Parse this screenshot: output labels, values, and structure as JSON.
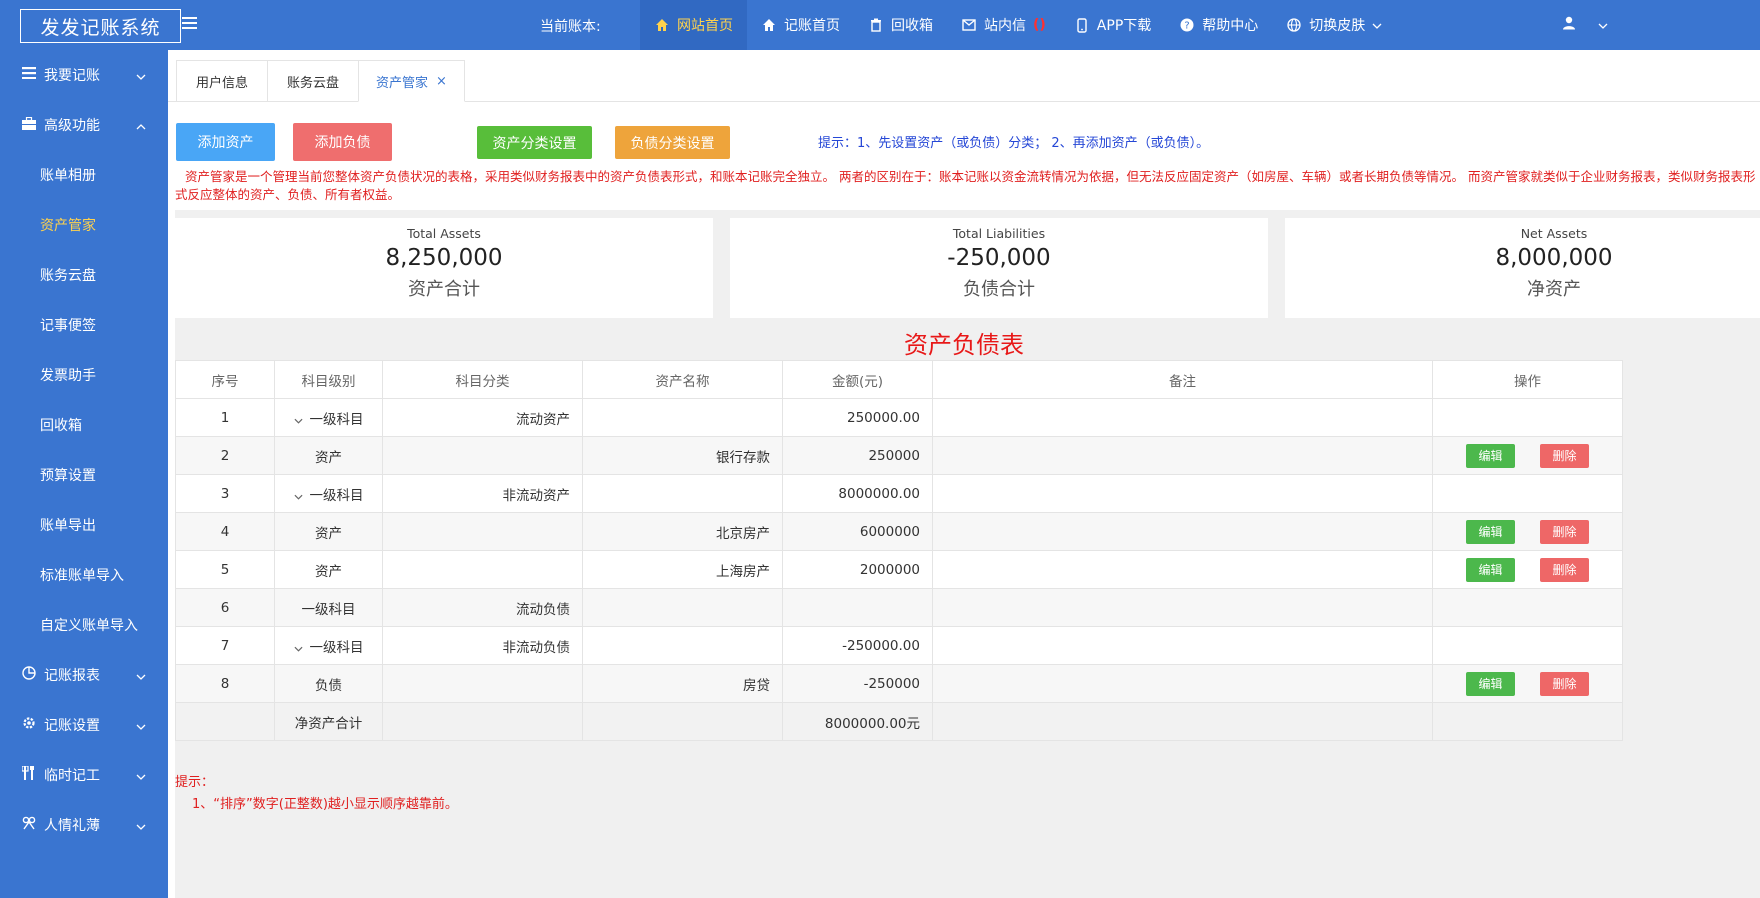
{
  "app": {
    "title": "发发记账系统"
  },
  "topbar": {
    "account_label": "当前账本:",
    "nav": [
      {
        "label": "网站首页",
        "icon": "home-icon",
        "active": true
      },
      {
        "label": "记账首页",
        "icon": "home-icon"
      },
      {
        "label": "回收箱",
        "icon": "trash-icon"
      },
      {
        "label": "站内信",
        "icon": "mail-icon",
        "count": "()"
      },
      {
        "label": "APP下载",
        "icon": "phone-icon"
      },
      {
        "label": "帮助中心",
        "icon": "help-icon"
      },
      {
        "label": "切换皮肤",
        "icon": "globe-icon"
      }
    ]
  },
  "sidebar": {
    "groups": [
      {
        "label": "我要记账",
        "icon": "bars-icon"
      },
      {
        "label": "高级功能",
        "icon": "briefcase-icon",
        "expanded": true
      }
    ],
    "sub_items": [
      "账单相册",
      "资产管家",
      "账务云盘",
      "记事便签",
      "发票助手",
      "回收箱",
      "预算设置",
      "账单导出",
      "标准账单导入",
      "自定义账单导入"
    ],
    "active_sub": "资产管家",
    "bottom_groups": [
      {
        "label": "记账报表",
        "icon": "pie-icon"
      },
      {
        "label": "记账设置",
        "icon": "gear-icon"
      },
      {
        "label": "临时记工",
        "icon": "tools-icon"
      },
      {
        "label": "人情礼薄",
        "icon": "gift-icon"
      }
    ]
  },
  "tabs": [
    {
      "label": "用户信息"
    },
    {
      "label": "账务云盘"
    },
    {
      "label": "资产管家",
      "active": true,
      "close": "×"
    }
  ],
  "toolbar": {
    "add_asset": "添加资产",
    "add_liability": "添加负债",
    "asset_category": "资产分类设置",
    "liability_category": "负债分类设置",
    "hint": "提示：1、先设置资产（或负债）分类；  2、再添加资产（或负债）。",
    "colors": {
      "add_asset": "#49a6f6",
      "add_liability": "#ef6e6e",
      "asset_category": "#58be3a",
      "liability_category": "#eea43b"
    }
  },
  "description": "资产管家是一个管理当前您整体资产负债状况的表格，采用类似财务报表中的资产负债表形式，和账本记账完全独立。 两者的区别在于：账本记账以资金流转情况为依据，但无法反应固定资产（如房屋、车辆）或者长期负债等情况。 而资产管家就类似于企业财务报表，类似财务报表形式反应整体的资产、负债、所有者权益。",
  "stats": [
    {
      "en": "Total Assets",
      "value": "8,250,000",
      "cn": "资产合计"
    },
    {
      "en": "Total Liabilities",
      "value": "-250,000",
      "cn": "负债合计"
    },
    {
      "en": "Net Assets",
      "value": "8,000,000",
      "cn": "净资产"
    }
  ],
  "report": {
    "title": "资产负债表",
    "headers": [
      "序号",
      "科目级别",
      "科目分类",
      "资产名称",
      "金额(元)",
      "备注",
      "操作"
    ],
    "rows": [
      {
        "no": "1",
        "level": "一级科目",
        "expand": true,
        "category": "流动资产",
        "name": "",
        "amount": "250000.00",
        "note": "",
        "actions": false
      },
      {
        "no": "2",
        "level": "资产",
        "expand": false,
        "category": "",
        "name": "银行存款",
        "amount": "250000",
        "note": "",
        "actions": true
      },
      {
        "no": "3",
        "level": "一级科目",
        "expand": true,
        "category": "非流动资产",
        "name": "",
        "amount": "8000000.00",
        "note": "",
        "actions": false
      },
      {
        "no": "4",
        "level": "资产",
        "expand": false,
        "category": "",
        "name": "北京房产",
        "amount": "6000000",
        "note": "",
        "actions": true
      },
      {
        "no": "5",
        "level": "资产",
        "expand": false,
        "category": "",
        "name": "上海房产",
        "amount": "2000000",
        "note": "",
        "actions": true
      },
      {
        "no": "6",
        "level": "一级科目",
        "expand": false,
        "category": "流动负债",
        "name": "",
        "amount": "",
        "note": "",
        "actions": false
      },
      {
        "no": "7",
        "level": "一级科目",
        "expand": true,
        "category": "非流动负债",
        "name": "",
        "amount": "-250000.00",
        "note": "",
        "actions": false
      },
      {
        "no": "8",
        "level": "负债",
        "expand": false,
        "category": "",
        "name": "房贷",
        "amount": "-250000",
        "note": "",
        "actions": true
      }
    ],
    "total_label": "净资产合计",
    "total_value": "8000000.00元",
    "edit_label": "编辑",
    "delete_label": "删除"
  },
  "tips": {
    "title": "提示：",
    "line": "1、“排序”数字(正整数)越小显示顺序越靠前。"
  }
}
